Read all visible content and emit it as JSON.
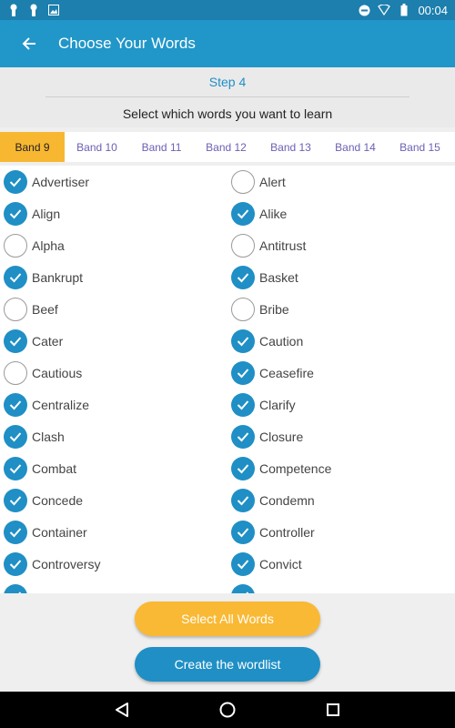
{
  "status_bar": {
    "time": "00:04"
  },
  "app_bar": {
    "title": "Choose Your Words"
  },
  "step": {
    "label": "Step 4",
    "instruction": "Select which words you want to learn"
  },
  "tabs": [
    {
      "label": "Band 9",
      "active": true
    },
    {
      "label": "Band 10",
      "active": false
    },
    {
      "label": "Band 11",
      "active": false
    },
    {
      "label": "Band 12",
      "active": false
    },
    {
      "label": "Band 13",
      "active": false
    },
    {
      "label": "Band 14",
      "active": false
    },
    {
      "label": "Band 15",
      "active": false
    }
  ],
  "words_left": [
    {
      "word": "Advertiser",
      "checked": true
    },
    {
      "word": "Align",
      "checked": true
    },
    {
      "word": "Alpha",
      "checked": false
    },
    {
      "word": "Bankrupt",
      "checked": true
    },
    {
      "word": "Beef",
      "checked": false
    },
    {
      "word": "Cater",
      "checked": true
    },
    {
      "word": "Cautious",
      "checked": false
    },
    {
      "word": "Centralize",
      "checked": true
    },
    {
      "word": "Clash",
      "checked": true
    },
    {
      "word": "Combat",
      "checked": true
    },
    {
      "word": "Concede",
      "checked": true
    },
    {
      "word": "Container",
      "checked": true
    },
    {
      "word": "Controversy",
      "checked": true
    },
    {
      "word": "",
      "checked": true
    }
  ],
  "words_right": [
    {
      "word": "Alert",
      "checked": false
    },
    {
      "word": "Alike",
      "checked": true
    },
    {
      "word": "Antitrust",
      "checked": false
    },
    {
      "word": "Basket",
      "checked": true
    },
    {
      "word": "Bribe",
      "checked": false
    },
    {
      "word": "Caution",
      "checked": true
    },
    {
      "word": "Ceasefire",
      "checked": true
    },
    {
      "word": "Clarify",
      "checked": true
    },
    {
      "word": "Closure",
      "checked": true
    },
    {
      "word": "Competence",
      "checked": true
    },
    {
      "word": "Condemn",
      "checked": true
    },
    {
      "word": "Controller",
      "checked": true
    },
    {
      "word": "Convict",
      "checked": true
    },
    {
      "word": "",
      "checked": true
    }
  ],
  "buttons": {
    "select_all": "Select All Words",
    "create": "Create the wordlist"
  },
  "colors": {
    "primary": "#2196c9",
    "accent": "#f8b731",
    "check_on": "#1f8fc5",
    "tab_text": "#6b5fb5"
  }
}
